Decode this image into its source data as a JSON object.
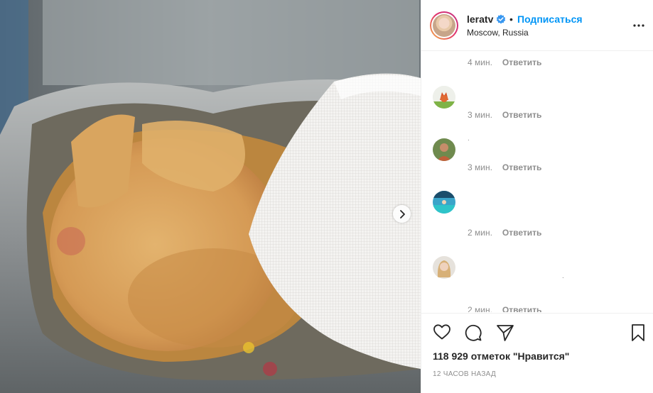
{
  "post": {
    "username": "leratv",
    "follow_label": "Подписаться",
    "separator": "•",
    "location": "Moscow, Russia",
    "likes_text": "118 929 отметок \"Нравится\"",
    "time_ago": "12 часов назад"
  },
  "comments": [
    {
      "time": "4 мин.",
      "reply": "Ответить",
      "text": ""
    },
    {
      "time": "3 мин.",
      "reply": "Ответить",
      "text": ""
    },
    {
      "time": "3 мин.",
      "reply": "Ответить",
      "text": "."
    },
    {
      "time": "2 мин.",
      "reply": "Ответить",
      "text": ""
    },
    {
      "time": "2 мин.",
      "reply": "Ответить",
      "text": "."
    }
  ],
  "icons": {
    "verified": "verified-badge-icon",
    "more": "more-options-icon",
    "like": "heart-icon",
    "comment": "comment-icon",
    "share": "paper-plane-icon",
    "save": "bookmark-icon",
    "next": "chevron-right-icon"
  },
  "colors": {
    "accent": "#0095f6",
    "muted": "#8e8e8e",
    "text": "#262626"
  }
}
